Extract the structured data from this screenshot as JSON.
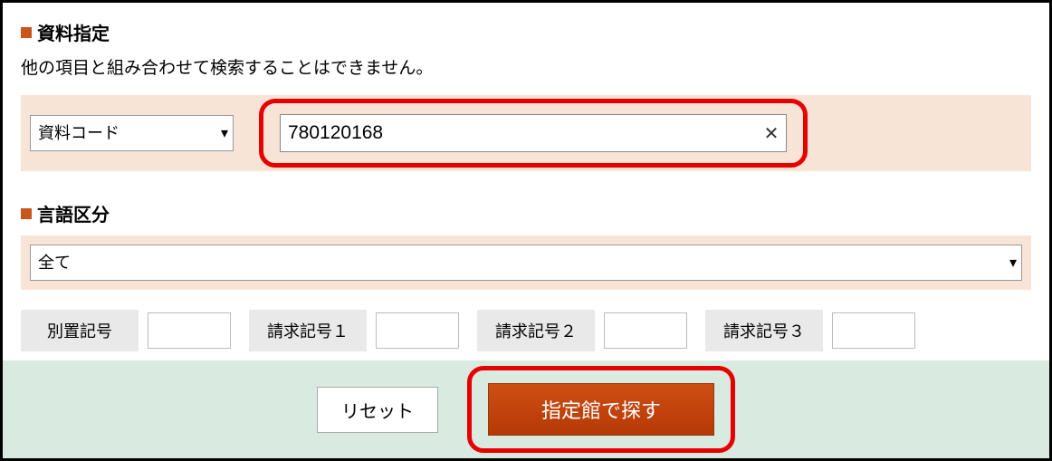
{
  "section1": {
    "heading": "資料指定",
    "note": "他の項目と組み合わせて検索することはできません。",
    "select_label": "資料コード",
    "input_value": "780120168"
  },
  "section2": {
    "heading": "言語区分",
    "select_label": "全て"
  },
  "call_numbers": {
    "label0": "別置記号",
    "label1": "請求記号１",
    "label2": "請求記号２",
    "label3": "請求記号３"
  },
  "buttons": {
    "reset": "リセット",
    "search": "指定館で探す"
  }
}
